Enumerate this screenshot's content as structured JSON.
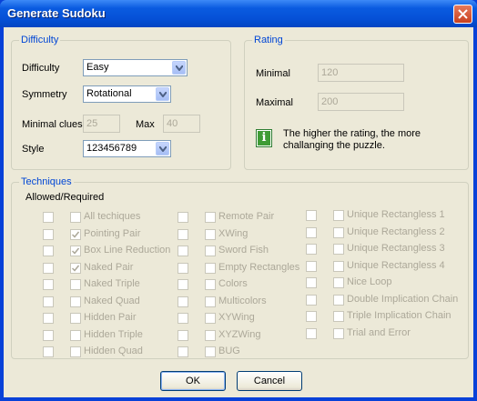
{
  "window": {
    "title": "Generate Sudoku"
  },
  "difficulty_group": {
    "legend": "Difficulty",
    "difficulty_label": "Difficulty",
    "difficulty_value": "Easy",
    "symmetry_label": "Symmetry",
    "symmetry_value": "Rotational",
    "min_clues_label": "Minimal clues",
    "min_clues_value": "25",
    "max_label": "Max",
    "max_value": "40",
    "style_label": "Style",
    "style_value": "123456789"
  },
  "rating_group": {
    "legend": "Rating",
    "minimal_label": "Minimal",
    "minimal_value": "120",
    "maximal_label": "Maximal",
    "maximal_value": "200",
    "info_text": "The higher the rating, the more challanging the puzzle."
  },
  "techniques_group": {
    "legend": "Techniques",
    "header": "Allowed/Required",
    "col1": [
      {
        "label": "All techiques",
        "allowed": false
      },
      {
        "label": "Pointing Pair",
        "allowed": true
      },
      {
        "label": "Box Line Reduction",
        "allowed": true
      },
      {
        "label": "Naked Pair",
        "allowed": true
      },
      {
        "label": "Naked Triple",
        "allowed": false
      },
      {
        "label": "Naked Quad",
        "allowed": false
      },
      {
        "label": "Hidden Pair",
        "allowed": false
      },
      {
        "label": "Hidden Triple",
        "allowed": false
      },
      {
        "label": "Hidden Quad",
        "allowed": false
      }
    ],
    "col2": [
      {
        "label": "Remote Pair"
      },
      {
        "label": "XWing"
      },
      {
        "label": "Sword Fish"
      },
      {
        "label": "Empty Rectangles"
      },
      {
        "label": "Colors"
      },
      {
        "label": "Multicolors"
      },
      {
        "label": "XYWing"
      },
      {
        "label": "XYZWing"
      },
      {
        "label": "BUG"
      }
    ],
    "col3": [
      {
        "label": "Unique Rectangless 1"
      },
      {
        "label": "Unique Rectangless 2"
      },
      {
        "label": "Unique Rectangless 3"
      },
      {
        "label": "Unique Rectangless 4"
      },
      {
        "label": "Nice Loop"
      },
      {
        "label": "Double Implication Chain"
      },
      {
        "label": "Triple Implication Chain"
      },
      {
        "label": "Trial and Error"
      }
    ]
  },
  "buttons": {
    "ok": "OK",
    "cancel": "Cancel"
  },
  "colors": {
    "titlebar": "#0550d6",
    "dialog_bg": "#ece9d8",
    "group_legend": "#0046d5",
    "disabled_text": "#aca899"
  }
}
